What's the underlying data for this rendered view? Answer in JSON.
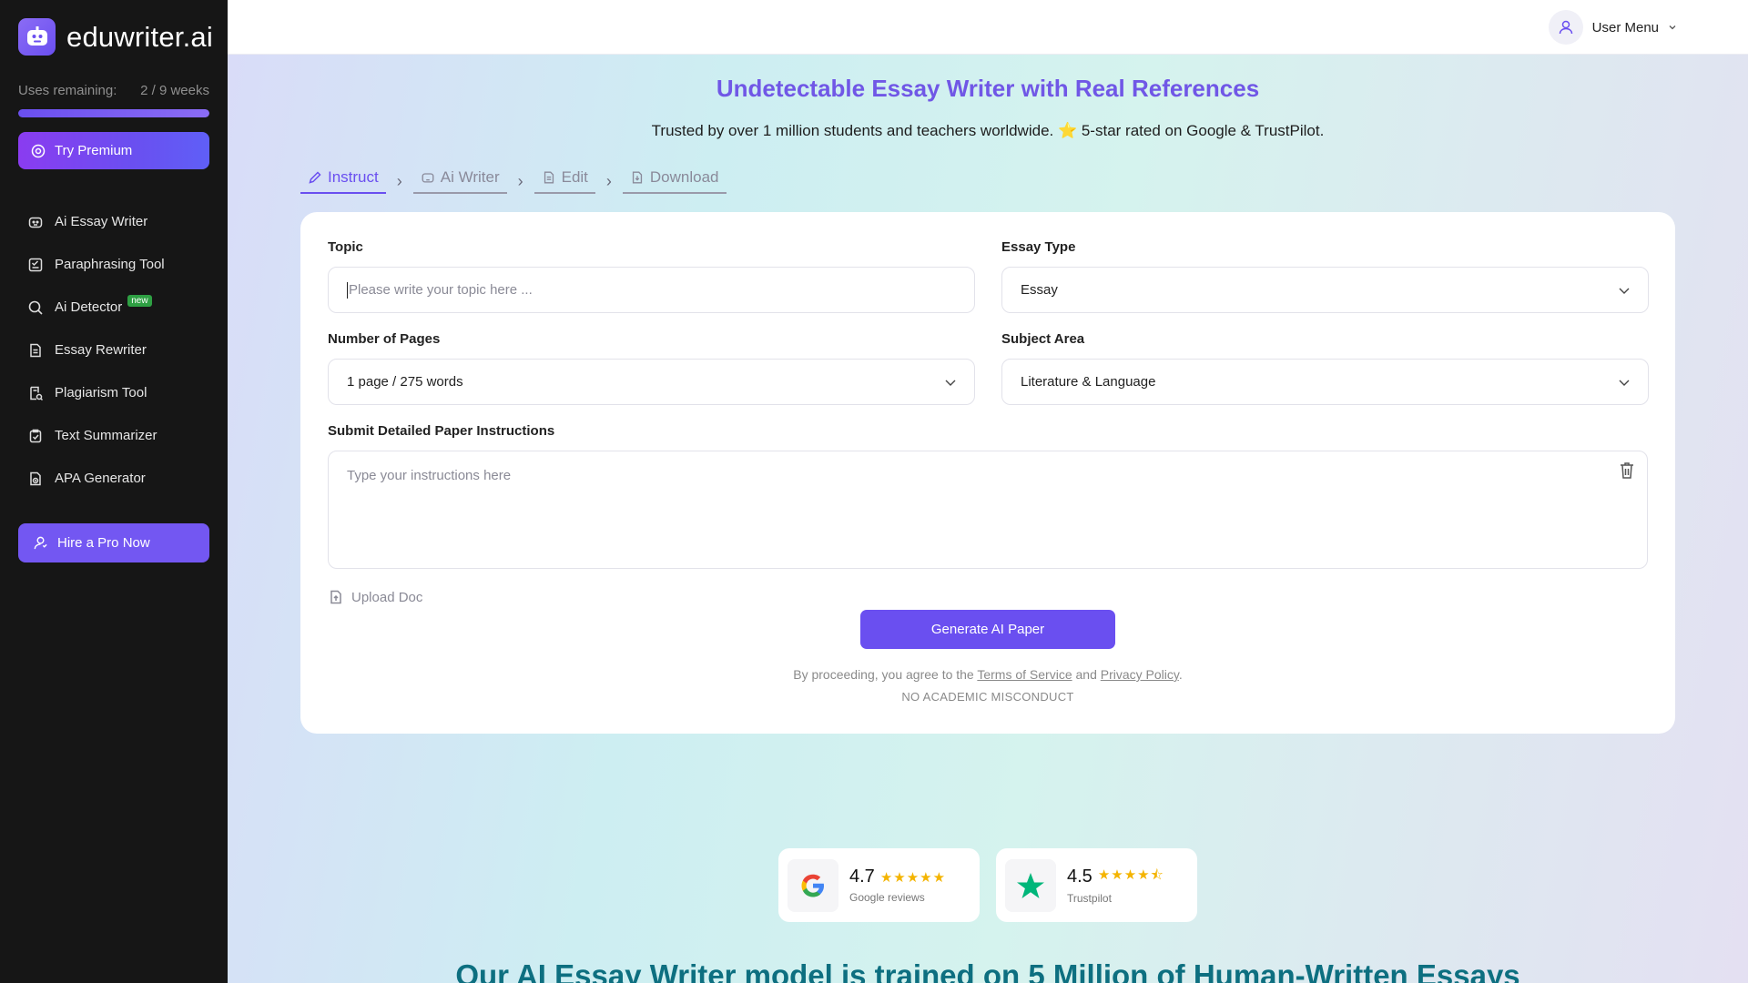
{
  "brand": {
    "name": "eduwriter.ai"
  },
  "usage": {
    "label": "Uses remaining:",
    "value": "2 / 9 weeks",
    "progress": 1.0
  },
  "sidebar": {
    "premium_label": "Try Premium",
    "items": [
      {
        "label": "Ai Essay Writer",
        "icon": "robot-icon"
      },
      {
        "label": "Paraphrasing Tool",
        "icon": "paraphrase-icon"
      },
      {
        "label": "Ai Detector",
        "icon": "search-icon",
        "badge": "new"
      },
      {
        "label": "Essay Rewriter",
        "icon": "document-icon"
      },
      {
        "label": "Plagiarism Tool",
        "icon": "document-search-icon"
      },
      {
        "label": "Text Summarizer",
        "icon": "clipboard-check-icon"
      },
      {
        "label": "APA Generator",
        "icon": "document-clock-icon"
      }
    ],
    "hire_label": "Hire a Pro Now"
  },
  "header": {
    "user_menu": "User Menu"
  },
  "hero": {
    "title": "Undetectable Essay Writer with Real References",
    "subtitle": "Trusted by over 1 million students and teachers worldwide. ⭐ 5-star rated on Google & TrustPilot."
  },
  "steps": [
    {
      "label": "Instruct",
      "active": true
    },
    {
      "label": "Ai Writer",
      "active": false
    },
    {
      "label": "Edit",
      "active": false
    },
    {
      "label": "Download",
      "active": false
    }
  ],
  "form": {
    "topic": {
      "label": "Topic",
      "placeholder": "Please write your topic here ...",
      "value": ""
    },
    "essay_type": {
      "label": "Essay Type",
      "value": "Essay"
    },
    "pages": {
      "label": "Number of Pages",
      "value": "1 page / 275 words"
    },
    "subject": {
      "label": "Subject Area",
      "value": "Literature & Language"
    },
    "instructions": {
      "label": "Submit Detailed Paper Instructions",
      "placeholder": "Type your instructions here"
    },
    "upload_label": "Upload Doc",
    "generate_label": "Generate AI Paper",
    "terms_prefix": "By proceeding, you agree to the",
    "terms_link": "Terms of Service",
    "terms_and": "and",
    "privacy_link": "Privacy Policy",
    "terms_suffix": ".",
    "notice": "NO ACADEMIC MISCONDUCT"
  },
  "reviews": [
    {
      "score": "4.7",
      "stars": "★★★★★",
      "source": "Google reviews"
    },
    {
      "score": "4.5",
      "stars": "★★★★⯪",
      "source": "Trustpilot"
    }
  ],
  "bottom_title": "Our AI Essay Writer model is trained on 5 Million of Human-Written Essays",
  "colors": {
    "accent": "#6a4ff0",
    "sidebar_bg": "#161616",
    "heading": "#7057e6",
    "teal_heading": "#0d6f80",
    "star": "#f4b400",
    "trustpilot": "#00b67a"
  }
}
